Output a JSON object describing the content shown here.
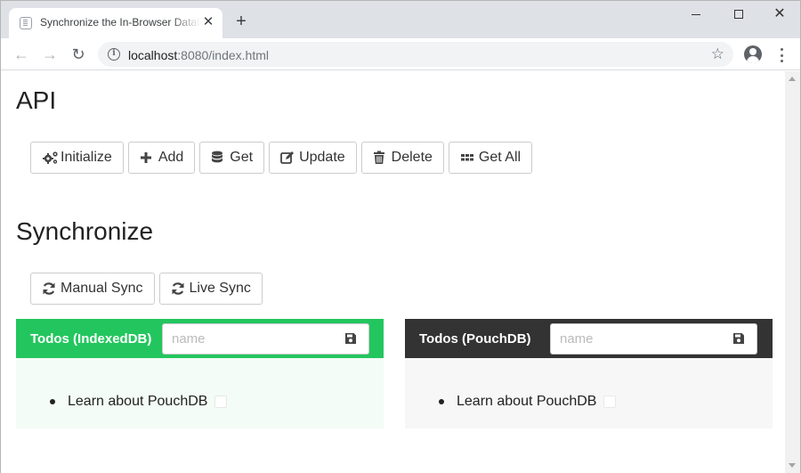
{
  "browser": {
    "tab_title": "Synchronize the In-Browser Datab",
    "tab_close": "✕",
    "new_tab": "+",
    "url_host": "localhost",
    "url_rest": ":8080/index.html",
    "info": "i",
    "star": "☆",
    "back": "←",
    "forward": "→",
    "reload": "↻",
    "close_window": "✕"
  },
  "api": {
    "heading": "API",
    "buttons": [
      {
        "label": "Initialize",
        "icon": "cogs-icon"
      },
      {
        "label": "Add",
        "icon": "plus-icon"
      },
      {
        "label": "Get",
        "icon": "database-icon"
      },
      {
        "label": "Update",
        "icon": "edit-icon"
      },
      {
        "label": "Delete",
        "icon": "trash-icon"
      },
      {
        "label": "Get All",
        "icon": "grid-icon"
      }
    ]
  },
  "sync": {
    "heading": "Synchronize",
    "buttons": [
      {
        "label": "Manual Sync",
        "icon": "sync-icon"
      },
      {
        "label": "Live Sync",
        "icon": "sync-icon"
      }
    ]
  },
  "panels": {
    "indexeddb": {
      "title": "Todos (IndexedDB)",
      "placeholder": "name",
      "color": "#23c65e",
      "items": [
        "Learn about PouchDB"
      ]
    },
    "pouchdb": {
      "title": "Todos (PouchDB)",
      "placeholder": "name",
      "color": "#333333",
      "items": [
        "Learn about PouchDB"
      ]
    }
  }
}
